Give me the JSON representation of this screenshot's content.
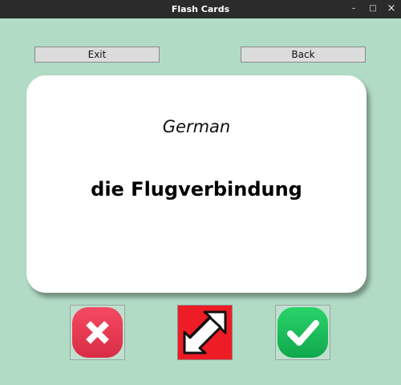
{
  "window": {
    "title": "Flash Cards",
    "controls": {
      "minimize": "–",
      "maximize": "□",
      "close": "×"
    }
  },
  "toolbar": {
    "exit_label": "Exit",
    "back_label": "Back"
  },
  "card": {
    "language": "German",
    "word": "die Flugverbindung"
  },
  "actions": [
    {
      "icon": "x-icon",
      "color": "#e8344f"
    },
    {
      "icon": "flip-arrows-icon",
      "color": "#ee1c24"
    },
    {
      "icon": "checkmark-icon",
      "color": "#17b957"
    }
  ],
  "colors": {
    "background": "#b1dbc5",
    "titlebar": "#2b2b2b",
    "card": "#ffffff"
  }
}
